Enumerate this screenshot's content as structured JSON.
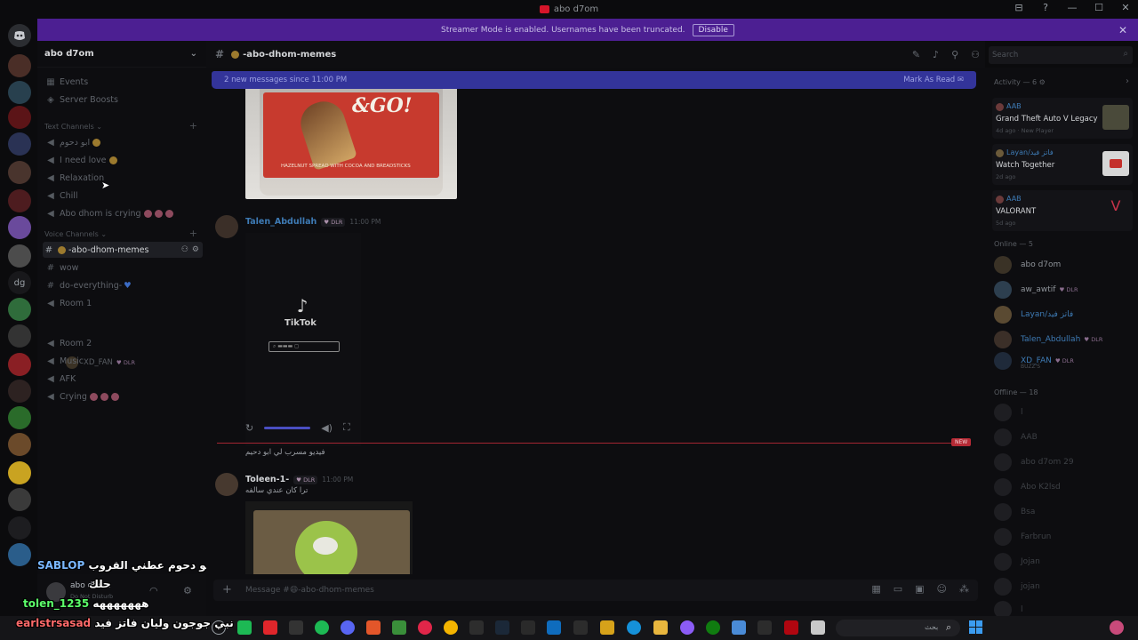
{
  "window": {
    "title": "abo d7om",
    "controls": [
      "⊟",
      "?",
      "—",
      "☐",
      "✕"
    ]
  },
  "banner": {
    "text": "Streamer Mode is enabled. Usernames have been truncated.",
    "disable_label": "Disable",
    "close_label": "✕"
  },
  "guild": {
    "name": "abo d7om",
    "chevron": "⌄"
  },
  "sidebar": {
    "top_items": [
      {
        "label": "Events",
        "icon": "calendar-icon"
      },
      {
        "label": "Server Boosts",
        "icon": "boost-icon"
      }
    ],
    "text_category": "Text Channels",
    "text_channels": [
      "ابو دحوم",
      "I need love",
      "Relaxation",
      "Chill",
      "Abo dhom is crying"
    ],
    "voice_category": "Voice Channels",
    "active_channel": "-abo-dhom-memes",
    "other_channels": [
      "wow",
      "do-everything-",
      "Room 1",
      "Room 2",
      "Music",
      "AFK",
      "Crying"
    ],
    "voice_user": {
      "name": "XD_FAN",
      "tag": "DLR"
    }
  },
  "user_panel": {
    "name": "abo d7om",
    "status": "Do Not Disturb"
  },
  "overlay": {
    "line1_name": "SABLOP",
    "line1_text": "لحظه ابو دحوم عطني القروب",
    "line2_text": "حلك",
    "line3_name": "tolen_1235",
    "line3_text": "هههههههه",
    "line4_name": "earlstrsasad",
    "line4_text": "نبي جوجون وليان فاتز فيد"
  },
  "chat_header": {
    "channel": "-abo-dhom-memes"
  },
  "search": {
    "placeholder": "Search"
  },
  "new_messages": {
    "text": "2 new messages since 11:00 PM",
    "action": "Mark As Read"
  },
  "media": {
    "nutella_text": "&GO!",
    "nutella_small": "HAZELNUT SPREAD WITH COCOA AND BREADSTICKS"
  },
  "messages": [
    {
      "author": "Talen_Abdullah",
      "tag": "DLR",
      "time": "11:00 PM",
      "tiktok": "TikTok"
    },
    {
      "caption": "فيديو مسرب لي ابو دحيم"
    },
    {
      "author": "Toleen-1-",
      "tag": "DLR",
      "time": "11:00 PM",
      "text": "ترا كان عندي سالفه"
    }
  ],
  "new_pill": "NEW",
  "composer": {
    "placeholder": "Message #😄-abo-dhom-memes"
  },
  "activity": {
    "header": "Activity — 6",
    "cards": [
      {
        "who": "AAB",
        "what": "Grand Theft Auto V Legacy",
        "meta": "4d ago · New Player"
      },
      {
        "who": "Layan/فاتز فيد",
        "what": "Watch Together",
        "meta": "2d ago"
      },
      {
        "who": "AAB",
        "what": "VALORANT",
        "meta": "5d ago"
      }
    ]
  },
  "online": {
    "header": "Online — 5",
    "members": [
      {
        "name": "abo d7om",
        "tag": ""
      },
      {
        "name": "aw_awtif",
        "tag": "DLR"
      },
      {
        "name": "Layan/فاتز فيد",
        "tag": ""
      },
      {
        "name": "Talen_Abdullah",
        "tag": "DLR"
      },
      {
        "name": "XD_FAN",
        "tag": "DLR",
        "sub": "BUZZ'S"
      }
    ]
  },
  "offline": {
    "header": "Offline — 18",
    "members": [
      "l",
      "AAB",
      "abo d7om 29",
      "Abo K2lsd",
      "Bsa",
      "Farbrun",
      "Jojan",
      "jojan",
      "l"
    ]
  },
  "taskbar": {
    "search_placeholder": "بحث"
  }
}
